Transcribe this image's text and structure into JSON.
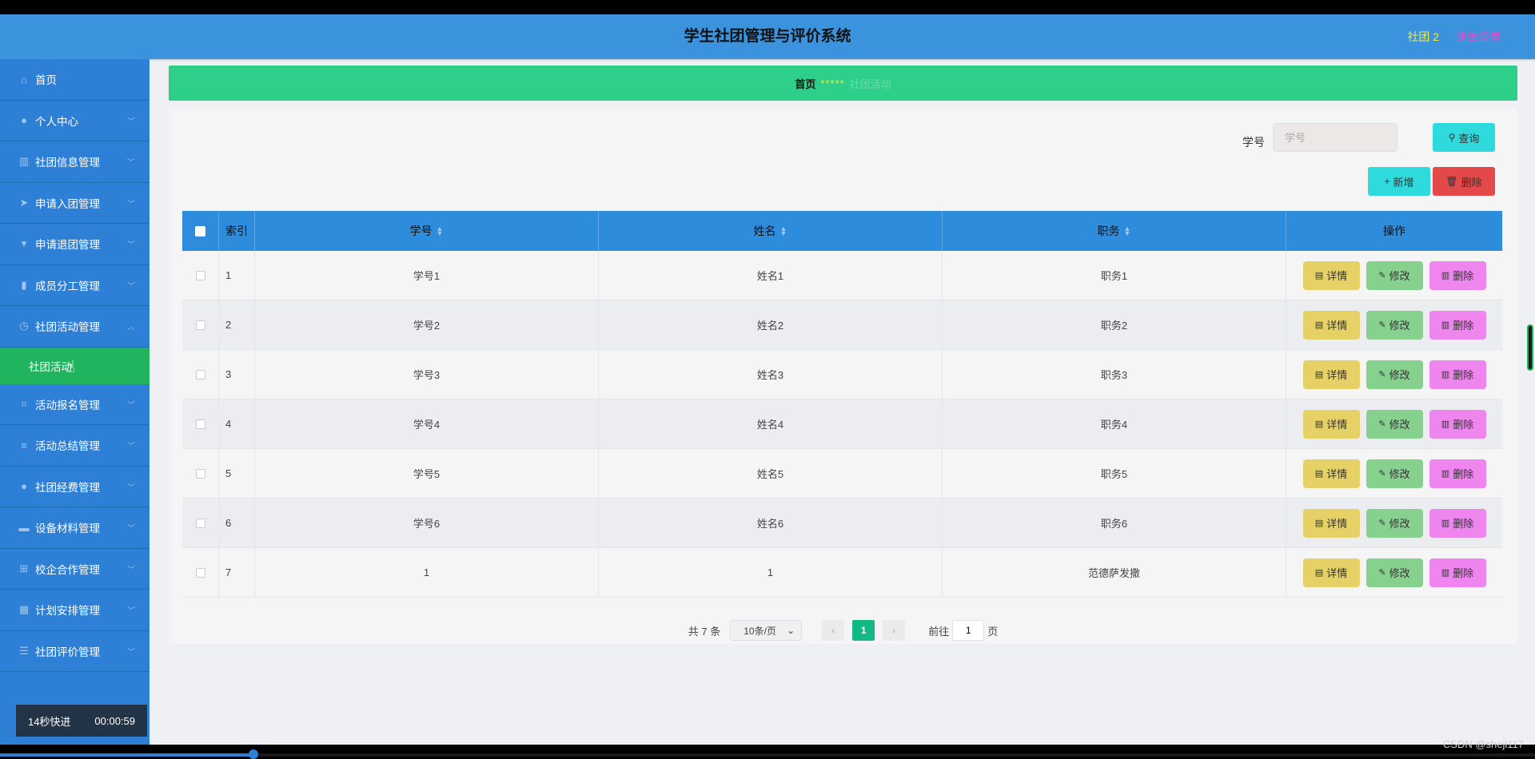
{
  "header": {
    "title": "学生社团管理与评价系统",
    "user": "社团 2",
    "logout": "退出登录"
  },
  "sidebar": {
    "items": [
      {
        "label": "首页",
        "icon": "home-icon",
        "chevron": false
      },
      {
        "label": "个人中心",
        "icon": "user-icon",
        "chevron": true
      },
      {
        "label": "社团信息管理",
        "icon": "books-icon",
        "chevron": true
      },
      {
        "label": "申请入团管理",
        "icon": "send-icon",
        "chevron": true
      },
      {
        "label": "申请退团管理",
        "icon": "pin-icon",
        "chevron": true
      },
      {
        "label": "成员分工管理",
        "icon": "bar-chart-icon",
        "chevron": true
      },
      {
        "label": "社团活动管理",
        "icon": "clock-icon",
        "chevron": true,
        "expanded": true
      }
    ],
    "active_sub": "社团活动",
    "items_after": [
      {
        "label": "活动报名管理",
        "icon": "crop-icon"
      },
      {
        "label": "活动总结管理",
        "icon": "list-icon"
      },
      {
        "label": "社团经费管理",
        "icon": "location-icon"
      },
      {
        "label": "设备材料管理",
        "icon": "briefcase-icon"
      },
      {
        "label": "校企合作管理",
        "icon": "grid-icon"
      },
      {
        "label": "计划安排管理",
        "icon": "apps-icon"
      },
      {
        "label": "社团评价管理",
        "icon": "sliders-icon"
      }
    ],
    "timer": {
      "label": "14秒快进",
      "time": "00:00:59"
    }
  },
  "breadcrumb": {
    "home": "首页",
    "separator": "*****",
    "current": "社团活动"
  },
  "search": {
    "label": "学号",
    "placeholder": "学号",
    "button": "查询"
  },
  "actions": {
    "add": "新增",
    "delete": "删除"
  },
  "table": {
    "headers": {
      "index": "索引",
      "col1": "学号",
      "col2": "姓名",
      "col3": "职务",
      "ops": "操作"
    },
    "rows": [
      {
        "index": "1",
        "col1": "学号1",
        "col2": "姓名1",
        "col3": "职务1"
      },
      {
        "index": "2",
        "col1": "学号2",
        "col2": "姓名2",
        "col3": "职务2"
      },
      {
        "index": "3",
        "col1": "学号3",
        "col2": "姓名3",
        "col3": "职务3"
      },
      {
        "index": "4",
        "col1": "学号4",
        "col2": "姓名4",
        "col3": "职务4"
      },
      {
        "index": "5",
        "col1": "学号5",
        "col2": "姓名5",
        "col3": "职务5"
      },
      {
        "index": "6",
        "col1": "学号6",
        "col2": "姓名6",
        "col3": "职务6"
      },
      {
        "index": "7",
        "col1": "1",
        "col2": "1",
        "col3": "范德萨发撒"
      }
    ],
    "op_labels": {
      "detail": "详情",
      "edit": "修改",
      "delete": "删除"
    }
  },
  "pagination": {
    "total": "共 7 条",
    "page_size": "10条/页",
    "current_page": "1",
    "goto_label": "前往",
    "goto_value": "1",
    "page_suffix": "页"
  },
  "video": {
    "watermark": "CSDN @sheji117",
    "progress": 0.165
  },
  "colors": {
    "header": "#3a93dc",
    "sidebar": "#2e7fd6",
    "active_menu": "#1fb45d",
    "breadcrumb_bar": "#2ecf88",
    "user_name": "#f5e84a",
    "logout": "#e84cc9",
    "query_button": "#2fdadc",
    "delete_button": "#e44949",
    "detail_button": "#e5d166",
    "edit_button": "#87d18f",
    "row_delete_button": "#ef85ee"
  }
}
